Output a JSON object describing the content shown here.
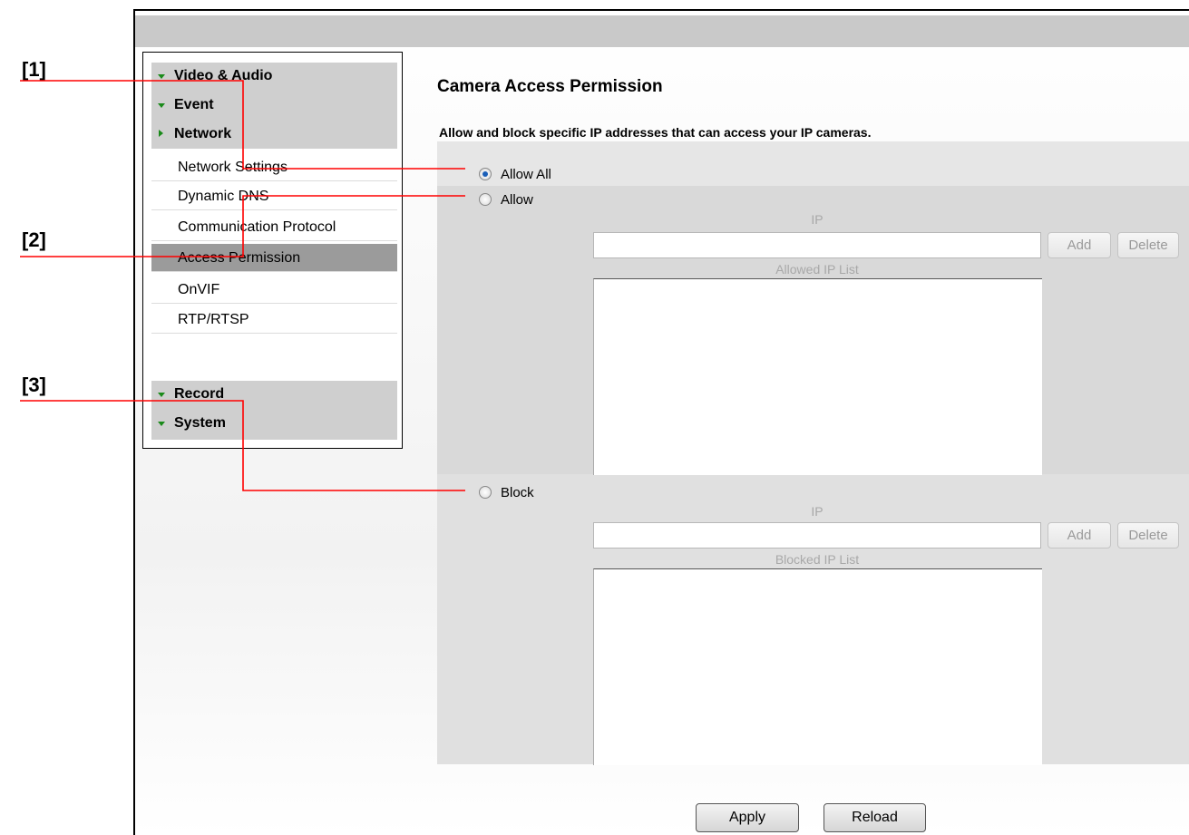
{
  "sidebar": {
    "top_groups": [
      {
        "label": "Video & Audio",
        "expanded": true
      },
      {
        "label": "Event",
        "expanded": true
      },
      {
        "label": "Network",
        "expanded": false
      }
    ],
    "items": [
      {
        "label": "Network Settings"
      },
      {
        "label": "Dynamic DNS"
      },
      {
        "label": "Communication Protocol"
      },
      {
        "label": "Access Permission",
        "active": true
      },
      {
        "label": "OnVIF"
      },
      {
        "label": "RTP/RTSP"
      }
    ],
    "bottom_groups": [
      {
        "label": "Record",
        "expanded": true
      },
      {
        "label": "System",
        "expanded": true
      }
    ]
  },
  "main": {
    "title": "Camera Access Permission",
    "description": "Allow and block specific IP addresses that can access your IP cameras.",
    "mode_options": [
      "Allow All",
      "Allow",
      "Block"
    ],
    "selected_mode": "Allow All",
    "allow": {
      "ip_label": "IP",
      "ip_value": "",
      "add_label": "Add",
      "delete_label": "Delete",
      "list_label": "Allowed IP List"
    },
    "block": {
      "ip_label": "IP",
      "ip_value": "",
      "add_label": "Add",
      "delete_label": "Delete",
      "list_label": "Blocked IP List"
    },
    "apply_label": "Apply",
    "reload_label": "Reload"
  },
  "annotations": [
    "[1]",
    "[2]",
    "[3]"
  ],
  "colors": {
    "annotation_line": "#ff0000",
    "expand_arrow": "#1a8a1a",
    "radio_selected": "#1b5fb8",
    "active_item_bg": "#9b9b9b"
  }
}
